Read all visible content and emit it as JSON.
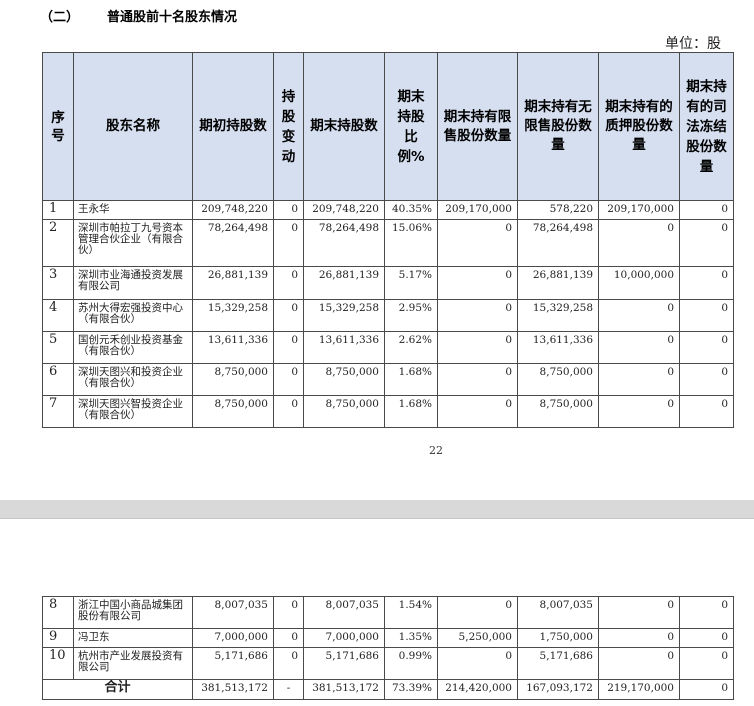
{
  "section": {
    "number": "（二）",
    "title": "普通股前十名股东情况"
  },
  "unit_label": "单位：股",
  "headers": [
    "序号",
    "股东名称",
    "期初持股数",
    "持股变动",
    "期末持股数",
    "期末持股比例%",
    "期末持有限售股份数量",
    "期末持有无限售股份数量",
    "期末持有的质押股份数量",
    "期末持有的司法冻结股份数量"
  ],
  "rows_page1": [
    {
      "seq": "1",
      "name": "王永华",
      "start": "209,748,220",
      "change": "0",
      "end": "209,748,220",
      "ratio": "40.35%",
      "restricted": "209,170,000",
      "unrestricted": "578,220",
      "pledged": "209,170,000",
      "frozen": "0"
    },
    {
      "seq": "2",
      "name": "深圳市帕拉丁九号资本管理合伙企业（有限合伙）",
      "start": "78,264,498",
      "change": "0",
      "end": "78,264,498",
      "ratio": "15.06%",
      "restricted": "0",
      "unrestricted": "78,264,498",
      "pledged": "0",
      "frozen": "0"
    },
    {
      "seq": "3",
      "name": "深圳市业海通投资发展有限公司",
      "start": "26,881,139",
      "change": "0",
      "end": "26,881,139",
      "ratio": "5.17%",
      "restricted": "0",
      "unrestricted": "26,881,139",
      "pledged": "10,000,000",
      "frozen": "0"
    },
    {
      "seq": "4",
      "name": "苏州大得宏强投资中心（有限合伙）",
      "start": "15,329,258",
      "change": "0",
      "end": "15,329,258",
      "ratio": "2.95%",
      "restricted": "0",
      "unrestricted": "15,329,258",
      "pledged": "0",
      "frozen": "0"
    },
    {
      "seq": "5",
      "name": "国创元禾创业投资基金（有限合伙）",
      "start": "13,611,336",
      "change": "0",
      "end": "13,611,336",
      "ratio": "2.62%",
      "restricted": "0",
      "unrestricted": "13,611,336",
      "pledged": "0",
      "frozen": "0"
    },
    {
      "seq": "6",
      "name": "深圳天图兴和投资企业（有限合伙）",
      "start": "8,750,000",
      "change": "0",
      "end": "8,750,000",
      "ratio": "1.68%",
      "restricted": "0",
      "unrestricted": "8,750,000",
      "pledged": "0",
      "frozen": "0"
    },
    {
      "seq": "7",
      "name": "深圳天图兴智投资企业（有限合伙）",
      "start": "8,750,000",
      "change": "0",
      "end": "8,750,000",
      "ratio": "1.68%",
      "restricted": "0",
      "unrestricted": "8,750,000",
      "pledged": "0",
      "frozen": "0"
    }
  ],
  "page_number": "22",
  "rows_page2": [
    {
      "seq": "8",
      "name": "浙江中国小商品城集团股份有限公司",
      "start": "8,007,035",
      "change": "0",
      "end": "8,007,035",
      "ratio": "1.54%",
      "restricted": "0",
      "unrestricted": "8,007,035",
      "pledged": "0",
      "frozen": "0"
    },
    {
      "seq": "9",
      "name": "冯卫东",
      "start": "7,000,000",
      "change": "0",
      "end": "7,000,000",
      "ratio": "1.35%",
      "restricted": "5,250,000",
      "unrestricted": "1,750,000",
      "pledged": "0",
      "frozen": "0"
    },
    {
      "seq": "10",
      "name": "杭州市产业发展投资有限公司",
      "start": "5,171,686",
      "change": "0",
      "end": "5,171,686",
      "ratio": "0.99%",
      "restricted": "0",
      "unrestricted": "5,171,686",
      "pledged": "0",
      "frozen": "0"
    }
  ],
  "total": {
    "label": "合计",
    "start": "381,513,172",
    "change": "-",
    "end": "381,513,172",
    "ratio": "73.39%",
    "restricted": "214,420,000",
    "unrestricted": "167,093,172",
    "pledged": "219,170,000",
    "frozen": "0"
  }
}
